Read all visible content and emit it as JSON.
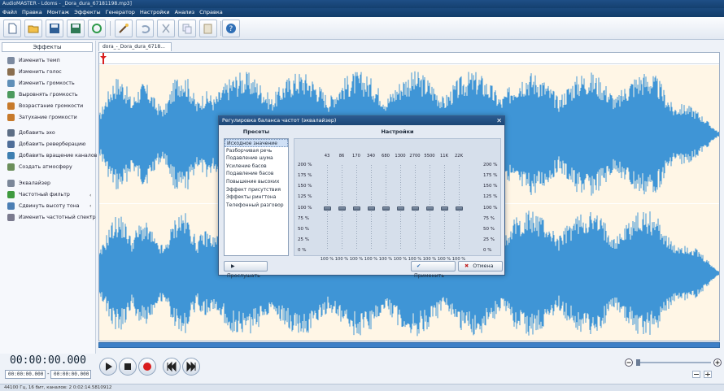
{
  "window": {
    "title": "AudioMASTER - Ldoms - _Dora_dura_67181198.mp3]"
  },
  "menu": [
    "Файл",
    "Правка",
    "Монтаж",
    "Эффекты",
    "Генератор",
    "Настройки",
    "Анализ",
    "Справка"
  ],
  "doc_tab": "dora_-_Dora_dura_6718...",
  "panel_tab": "Эффекты",
  "effects": [
    {
      "label": "Изменить темп",
      "color": "#7c8aa0"
    },
    {
      "label": "Изменить голос",
      "color": "#8a6e4e"
    },
    {
      "label": "Изменить громкость",
      "color": "#5f8fb8"
    },
    {
      "label": "Выровнять громкость",
      "color": "#4c9a5e"
    },
    {
      "label": "Возрастание громкости",
      "color": "#c77a2b"
    },
    {
      "label": "Затухание громкости",
      "color": "#c77a2b"
    },
    {
      "label": "Добавить эхо",
      "color": "#5d6e85"
    },
    {
      "label": "Добавить реверберацию",
      "color": "#4f6e99"
    },
    {
      "label": "Добавить вращение каналов",
      "color": "#3e7fb1"
    },
    {
      "label": "Создать атмосферу",
      "color": "#6b8e5a"
    },
    {
      "label": "Эквалайзер",
      "color": "#7b8799"
    },
    {
      "label": "Частотный фильтр",
      "color": "#3f9a3f"
    },
    {
      "label": "Сдвинуть высоту тона",
      "color": "#4b7eb4"
    },
    {
      "label": "Изменить частотный спектр",
      "color": "#7a7a8e"
    }
  ],
  "time": {
    "current": "00:00:00.000",
    "start": "00:00:00.000",
    "separator": "-",
    "end": "00:00:00.000"
  },
  "status": "44100 Гц, 16 бит, каналов: 2   0:02:14.5810912",
  "dialog": {
    "title": "Регулировка баланса частот (эквалайзер)",
    "presets_title": "Пресеты",
    "settings_title": "Настройки",
    "presets": [
      "Исходное значение",
      "Разборчивая речь",
      "Подавление шума",
      "Усиление басов",
      "Подавление басов",
      "Повышение высоких",
      "Эффект присутствия",
      "Эффекты рингтона",
      "Телефонный разговор"
    ],
    "selected_preset": 0,
    "frequencies": [
      "43",
      "86",
      "170",
      "340",
      "680",
      "1300",
      "2700",
      "5500",
      "11K",
      "22K"
    ],
    "scale": [
      "200 %",
      "175 %",
      "150 %",
      "125 %",
      "100 %",
      "75 %",
      "50 %",
      "25 %",
      "0 %"
    ],
    "band_values": [
      "100 %",
      "100 %",
      "100 %",
      "100 %",
      "100 %",
      "100 %",
      "100 %",
      "100 %",
      "100 %",
      "100 %"
    ],
    "band_levels": [
      100,
      100,
      100,
      100,
      100,
      100,
      100,
      100,
      100,
      100
    ],
    "listen_label": "Прослушать",
    "apply_label": "Применить",
    "cancel_label": "Отмена"
  },
  "colors": {
    "waveform": "#3f95d6",
    "wave_bg": "#fff6e6",
    "accent": "#1c4675"
  }
}
